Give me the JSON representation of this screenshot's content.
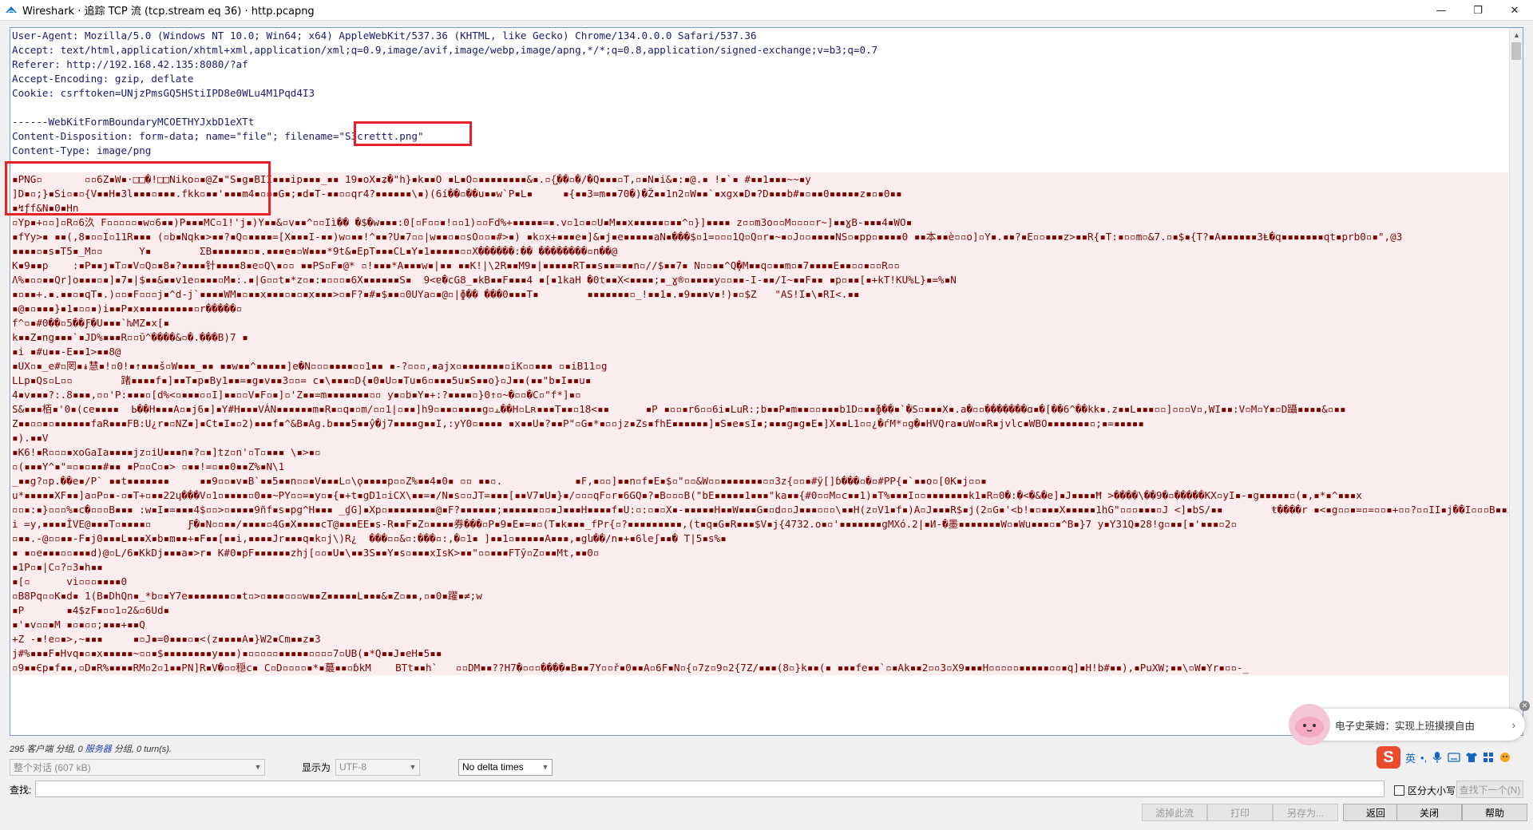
{
  "window": {
    "title": "Wireshark · 追踪 TCP 流 (tcp.stream eq 36) · http.pcapng",
    "controls": {
      "minimize": "—",
      "maximize": "❐",
      "close": "✕"
    }
  },
  "stream": {
    "header_lines": [
      "User-Agent: Mozilla/5.0 (Windows NT 10.0; Win64; x64) AppleWebKit/537.36 (KHTML, like Gecko) Chrome/134.0.0.0 Safari/537.36",
      "Accept: text/html,application/xhtml+xml,application/xml;q=0.9,image/avif,image/webp,image/apng,*/*;q=0.8,application/signed-exchange;v=b3;q=0.7",
      "Referer: http://192.168.42.135:8080/?af",
      "Accept-Encoding: gzip, deflate",
      "Cookie: csrftoken=UNjzPmsGQ5HStiIPD8e0WLu4M1Pqd4I3",
      "",
      "------WebKitFormBoundaryMCOETHYJxbD1eXTt",
      "Content-Disposition: form-data; name=\"file\"; filename=\"S3crettt.png\"",
      "Content-Type: image/png",
      ""
    ],
    "body_lines": [
      "▪PNG▫       ▫▫6Z▪W▪·□□�!□□Niko▫▪@Z▪\"S▪g▪BII▪▪▪ip▪▪▪_▪▪ 19▪oX▪ʑ�\"h}▪k▪▪O ▪L▪O▫▪▪▪▪▪▪▪▪&▪.▫{͓��▫�/�Q▪▪▪▫T,▫▪N▪i&▪:▪@.▪ !▪`▪ #▪▪1▪▪▪~~▪y",
      "]D▪▫;}▪Si▫▪▫{V▪▪H▪3l▪▪▪▫▪▪▪.fkk▫▪▪'▪▪▪m4▪▫▫▪G▪;▪d▪T-▪▪▫▫qr4?▪▪▪▪▪▪\\▪)(6í��▫��u▪▪w`P▪L▪     ▪{▪▪3=m▪▪70�)�Ž▪▪1n2▫W▪▪`▪xgx▪D▪?D▪▪▪b#▪▫▪▪0▪▪▪▪▪z▪▫▪0▪▪",
      "▪↯ƒf&N▪0▪Hn",
      "▫Yp▪+▫▫]▫R▫6汣 F▫▫▫▫▫▪w▫6▪▪)P▪▪▪MC▫1!'j▪)Y▪▪&▫v▪▪^▫▫Iì�� �$�w▪▪▪:0[▫F▫▫▪!▫▫1)▫▫Fd%+▪▪▪▪▪=▪.v▫1▫▪▫U▪M▪▪x▪▪▪▪▪▫▪▪^▫}]▪▪▪▪ z▫▫m3o▫▫M▫▫▫▫r~]▪▪ɣB-▪▪▪4▪WO▪",
      "▪fYy>▪ ▪▪(,8▪▫▫I▫11R▪▪▪ (▫b▪Nqk▪>▪▪?▪Q▫▪▪▪▪=[X▪▪▪I-▪▪)w▫▪▪!^▪▪?U▪7▫▫|w▪▪▫▪▫sO▫▫▪#>▪) ▪k▫x+▪▪▪e▪]&▪j▪e▪▪▪▪▪aN▪���$▫1=▫▫▫1Q▫Q▫r▪~▪▫J▫▫▪▪▪▪NS▫▪pp▫▪▪▪▪0 ▪▪本▪▪è▫▫o]▫Y▪.▪▪?▪E▫▫▪▪▪z>▪▪R{▪T:▪▫▫m▫&7.▫▪$▪{T?▪A▪▪▪▪▪▪3Ⱡ�q▪▪▪▪▪▪▪qt▪prb0▫▪\",@3",
      "▪▪▪▪▫▪s▪T5▪_M▫▫      Y▪        ΣB▪▪▪▪▪▪▫▪.▪▪▪e▪▫W▪▪▪*9t&▪EpT▪▪▪CL▪Y▪1▪▪▪▪▪▫▫X������:�� ��������▫n��@",
      "K▪9▪▪p    :▪P▪▪ȷ▪T▫▪V▫Q▫▪8▪?▪▪▪▪针▪▪▪▪8▪e▫Q\\▪▫▫ ▪▪PS▫F▪@* ▫!▪▪▪*A▪▪▪w▪|▪▪ ▪▪K!|\\2R▪▪M9▪|▪▪▪▪▪RT▪▪s▪▪=▪▪n▫//$▪▪7▪ N▫▫▪▪^Q֑�M▪▪q▫▪▪m▫▪7▪▪▪▪E▪▪▫▫▪▫▫R▫▫",
      "Ʌ%▪▫▫▪▪Qr]o▪▪▪▫▪]▪7▪|$▪▪&▪▪v1e▫▪▪▪▫M▪:.▪|G▫▫t▪*z▫▪:▪▫▫▫▪6X▪▪▪▪▪▪S▪  9<ɐ�cG8_▪kB▪▪F▪▪▪4 ▪[▪1kaH �0t▪▪X<▪▪▪▪;▪_ɣ®▫▪▪▪▪y▫▫▪▪-I-▪▪/I~▪▪F▪▪ ▪p▫▪▪[▪+kT!KU%L}▪=%▪N",
      "▪▫▪▪+.▪.▪▪▫▪qT▪.)▫▫▪F▫▫▫j▪^d-j`▪▪▪▪WM▪▫▪▪x▪▪▪▫▪▫▪x▪▪▪>▫▪F?▪#▪$▪▪▫0UYa▫▪@▫|ɸ�� ���0▪▪▪T▪        ▪▪▪▪▪▪▪▫_!▪▪1▪.▪9▪▪▪v▪!)▪▫$Z   \"AS!I▪\\▪RI<.▪▪",
      "▪@▪▫▪▪▪}▪1▪▫▫▪)i▪▪P▪x▪▪▪▪▪▪▪▪▪▫r�����▫",
      "f^▫▪#0��▫5��Ƒ�U▪▪▪`ƕMZ▪x[▪",
      "k▪▪Z▪ng▪▪▪`▪JD%▪▪▪R▫▫ῡ^����&▫�.���B)7 ▪",
      "▪i ▪#u▪▪-E▪▪1>▪▪8@",
      "▪UX▫▪_e#▫罔▪↡慧▪!▫0!▪↑▪▪▪š▫W▪▪▪_▪▪ ▪▪w▪▪^▪▪▪▪▪]e�N▫▫▫▪▪▪▪▫▫1▪▪ ▪-?▫▫▫,▪ajx▫▪▪▪▪▪▪▪▫iK▫▫▪▪▪ ▫▪iB11▫g",
      "LLp▪Qs▫L▫▫        踷▪▪▪▪f▪]▪▪T▪p▪By1▪▪=▪g▪v▪▪3▫▫= c▪\\▪▪▪▫D{▪0▪U▫▪Tu▪6▫▪▪▪5u▪S▪▪o}▫J▪▪(▪▪\"b▪I▪▪u▪",
      "4▪v▪▪▪?:.8▪▪▪,▫▫'P:▪▪▪▫[d%<▫▪▪▪▫▫I]▪▪▫▫V▪F▫▪]▫'Z▪▪=m▪▪▪▪▪▪▪▫▫ y▪▫b▪Y▪+:?▪▪▪▪▫}0↑▫~�▫▫�C▫\"f*]▪▫",
      "S&▪▪▪栢▪'0▪(ce▪▪▪▪  Ь��H▪▪▪A▫▪j6▪]▪Y#H▪▪▪VÁN▪▪▪▪▪▪m▪R▪▫q▪▫m/▫▫1|▫▪▪]h9▫▪▪▫▪▪▪▪g▫⫠��H▫Lʀ▪▪▪T▪▪▫18<▪▪      ▪P ▪▫▫▪r6▫▫6i▪LuR:;b▪▪P▪m▪▪▫▫▪▪▪b1D▫▪▪ɸ��▪`�S▫▪▪▪X▪.a�▫▫�������ɑ▪�[��6^��kk▪.z▪▪L▪▪▪▫▫]▫▫▫V▫,WI▪▪:V▫M▫Y▪▫D躡▪▪▪▪&▫▪▪",
      "Z▪▪▫▫▪▫▪▪▪▪▪▪faR▪▪▪FB:U¿r▪▫NZ▪]▪Ct▪I▪▫2)▪▪▪f▪^&B▪Ag.b▪▪▪5▪▪ŷ�j7▪▪▪▪g▪▪I,:yY0▫▪▪▪▪ ▪x▪▪U▪?▪▪P\"▫G▪*▪▫▫jz▪Zs▪fhE▪▪▪▪▪▪]▪S▪e▪sI▪;▪▪▪g▪g▪E▪]X▪▪L1▫▫¿�ѓM*▫g�▪HVQra▪uW▫▪R▪jvlc▪WBO▪▪▪▪▪▪▪▫;▪=▪▪▪▪▪",
      "▪).▪▪V",
      "▪K6!▪R▫▫▫▪xoGaIa▪▪▪▪jz▫iU▪▪▪n▪?▫▪]tz▫n'▫T▫▪▪▪ \\▪>▪▫",
      "▫(▪▪▪Y^▪\"=▫▪▫▪▪#▪▪ ▪P▫▫C▫▪> ▫▪▪!=▫▪▪0▪▪Z%▪N\\1",
      "_▪▪g?▫p.��e▪/P` ▪▪t▪▪▪▪▪▪▪     ▪▪9▫▫▪v▪B`▪▪5▪▪n▫▫▪V▪▪▪L▫\\ǫ▪▪▪▪p▫▫Z%▪▪4▪0▪ ▫▫ ▪▪▫.            ▪F,▪▫▫]▪▪n▫f▪E▪$▫\"▫▫&W▫▫▪▪▪▪▪▪▪▫▫3z{▫▫▪#ÿ[]ɓ���▫�▫#PP{▪`▪▪o▫[0K▪j▫▫▪",
      "u*▪▪▪▪▪XF▪▪]a▫P▫▪-▫▪T+▫▪▪22ɥ���V▫1▫▪▪▪▪▫0▪▪~PY▫▫=▪y▫▪{▪+t▪gD1▫iCX\\▪▪=▪/N▪s▫▫JT=▪▪▪[▪▪V7▪U▪}▪/▫▫▫qF▫r▪6GQ▪?▪B▫▫▫B(\"bE▪▪▪▪▪1▪▪▪\"ka▪▪{#0▫▫M▫c▪▪1)▪T%▪▪▪I▫▫▪▪▪▪▪▪▪k1▪R▫0�:�<�&�e]▪J▪▪▪▪Ħ >����\\��9�▫�����KX▫yI▪-▪g▪▪▪▪▪▫(▪,▪*▪^▪▪▪x",
      "▫▫▪:▪}▫▫▫%▪c�▫▫▫B▪▪▪ :w▪I▪=▪▪▪4$▫▫>▫▪▪▪▪9ñf▪s▪pg^H▪▪▪ _ɠG]▪Xp▫▪▪▪▪▪▪▪▪@▪F?▪▪▪▪▪▪;▪▪▪▪▪▪▫▫▪J▪▪▪H▪▪▪▪f▪U:▫:▫▪▫X▪-▪▪▪▪▪H▪▪W▪▪▪G▪▫d▫▫J▪▪▪▫▫▫\\▪▪H(z▫V1▪f▪)A▫J▪▪▪R$▪j(2▫G▪'<b!▪▫▪▪▪X▪▪▪▪▪1hG\"▫▫▫▪▪▪▫J <]▪bS/▪▪        ŧ����r ▪<▪g▫▫▪=▫=▫▫▪+▫▫?▫▫II▪j��I▫▫▫B▪▪x!▪",
      "i =y,▪▪▪▪ÎVE@▪▪▪T▫▪▪▪▪▫      Ƒ�▪N▫▫▪▪/▪▪▪▪▫4G▪X▪▪▪▪cT@▪▪▪EE▪s-R▪▪F▪Z▫▪▪▪▪券���▫P▪9▪E▪=▪▫(T▪k▪▪▪_fPr{▫?▪▪▪▪▪▪▪▪▪,(t▪q▪G▪R▪▪▪$V▪ј{4732.o▪▫'▪▪▪▪▪▪▪gMXó.2|▪И-�墨▪▪▪▪▪▪▪W▫▪Wu▪▪▪▫▪^B▪}7 y▪Y31Q▪28!g▫▪▪[▪'▪▪▪▫2▫",
      "▫▪▪.-@▫▫▪▪-F▪j0▪▪▪L▪▪▪X▪b▪m▪▪+▪F▪▪[▪▪i,▪▪▪▪Jr▪▪▪q▪k▫j\\)R¿  ���▫▫&▫:���▫:,�▫1▪ ]▪▪1▫▪▪▪▪▪A▪▪▪,▪gն��/ո▪+▪6leʃ▪▪� T|5▪s%▪",
      "▪ ▪▫e▪▪▪▫▫▪▪▪d)@▫L/6▪KkDj▪▪▪a▪>r▪ K#0▪pF▪▪▪▪▪▪zhj[▫▫▪U▪\\▪▪3S▪▪Y▪s▫▪▪▪xIsK>▪▪\"▫▫▪▪▪FTȳ▫Z▫▪▪Mt,▪▪0▫",
      "▪1P▫▪|C▫?▫3▪h▪▪",
      "▪[▫      vi▫▫▫▪▪▪▪0",
      "▫B8Pq▫▫K▪d▪ 1(B▪DhQn▪_*b▫▪Y7e▪▪▪▪▪▪▪▫▪t▫>▫▪▪▪▫▫▫w▪▪Z▪▪▪▪▪L▪▪▪&▪Z▫▪▪,▫▪0▪躍▪≠;w",
      "▪P       ▪4$zF▪▫▫1▫2&▫6Ud▪",
      "▪'▪v▫▫▪M ▪▫▪▫▫;▪▪▪+▪▪Q",
      "+Z -▪!e▫▪>,~▪▪▪     ▪▫J▪=0▪▪▪▫▪<(z▪▪▪▪A▪}W2▪Cm▪▪z▪3",
      "j#%▪▪▪F▪Hvq▪▫▪x▪▪▪▪▪~▫▫▪$▪▪▪▪▪▪▪▪y▪▪▪)▪▫▫▫▫▫▪▪▪▪▪▫▫▫▫7▫UB(▪*Q▪▪J▪eH▪5▪▪",
      "▫9▪▪Єp▪f▪▪,▫D▪R%▪▪▪▪RM▫2▫1▪▪PN]R▪V�▫▫穏c▪ C▫D▫▫▫▫▪*▪蕞▪▪▫ɓkM    BTt▪▪h`   ▫▫DM▪▪??H7�▫▫▫����▪B▪▪7Y▫▫ř▪0▪▪A▫6F▪N▫{▫7z▫9▫2{7Z/▪▪▪(8▫}k▪▪(▪ ▪▪▪fe▪▪`▫▪Ak▪▪2▫▫3▫X9▪▪▪H▫▫▫▫▫▪▪▪▪▪▫▫▪q]▪H!b#▪▪),▪PuXW;▪▪\\▫W▪Yr▪▫▫-_"
    ],
    "highlight_filename": "\"S3crettt.png\""
  },
  "status": {
    "client_pkts": "295 客户端 分组,",
    "server_pkts_prefix": "0",
    "server_label": "服务器",
    "server_pkts_suffix": "分组,",
    "turns": "0 turn(s)."
  },
  "controls": {
    "conversation_select": "整个对话 (607 kB)",
    "show_as_label": "显示为",
    "encoding_select": "UTF-8",
    "delta_select": "No delta times",
    "find_label": "查找:",
    "find_value": "",
    "case_sensitive_label": "区分大小写",
    "find_next_button": "查找下一个(N)",
    "filter_out_button": "滤掉此流",
    "print_button": "打印",
    "save_as_button": "另存为...",
    "back_button": "返回",
    "close_button": "关闭",
    "help_button": "帮助"
  },
  "ime": {
    "logo": "S",
    "lang": "英",
    "punct": "•,"
  },
  "bubble": {
    "text": "电子史莱姆：实现上班摸摸自由",
    "arrow": "›"
  },
  "colors": {
    "accent_red": "#e8202a",
    "client_text": "#1a1a6e",
    "body_text": "#7a0000",
    "body_bg": "#fbeded"
  }
}
